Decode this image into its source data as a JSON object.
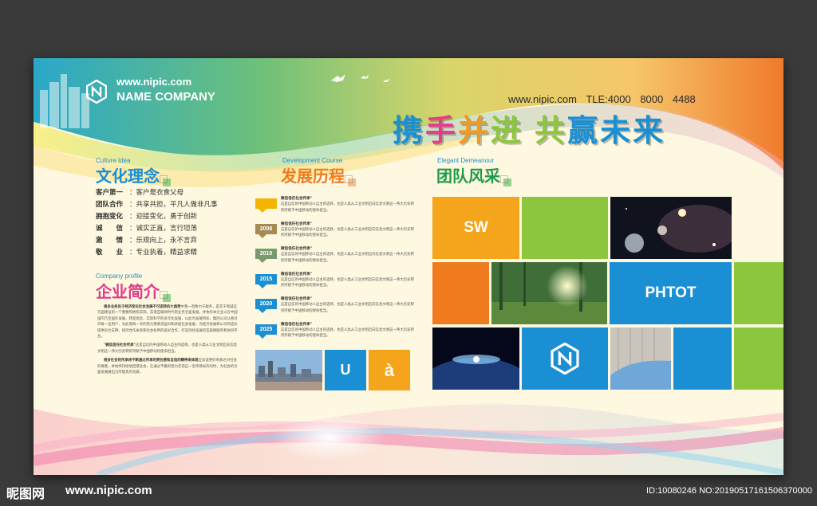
{
  "brand": {
    "url": "www.nipic.com",
    "name": "NAME COMPANY"
  },
  "contact": "www.nipic.com  TLE:4000 8000 4488",
  "slogan": {
    "chars": [
      "携",
      "手",
      "并",
      "进",
      " ",
      "共",
      "赢",
      "未",
      "来"
    ],
    "colors": [
      "#1b8fd3",
      "#e83b8c",
      "#f09a22",
      "#8cc63f",
      "#ffffff",
      "#8cc63f",
      "#1b8fd3",
      "#1b8fd3",
      "#1b8fd3"
    ]
  },
  "culture": {
    "en": "Culture Idea",
    "title": "文化理念",
    "color": "#1b8fd3",
    "items": [
      {
        "key": "客户第一",
        "value": "：客户是衣食父母"
      },
      {
        "key": "团队合作",
        "value": "：共享共担，平凡人做非凡事"
      },
      {
        "key": "拥抱变化",
        "value": "：迎接变化，勇于创新"
      },
      {
        "key": "诚　　信",
        "value": "：诚实正直，言行坦荡"
      },
      {
        "key": "激　　情",
        "value": "：乐观向上，永不言弃"
      },
      {
        "key": "敬　　业",
        "value": "：专业执着，精益求精"
      }
    ]
  },
  "company": {
    "en": "Company profile",
    "title": "企业简介",
    "color": "#e0398a",
    "paragraphs": [
      {
        "lead": "很多业务处于经济变化社会发展不可逆转的大趋势",
        "text": "中我一直致力于服务，是实干和诚信方面建设的一个重要和依照实际，实现互联网时代的业务全面发展，并依托本企业以在中国国内乃至国外发展，转变观念，实现科学的多元化发展，以此为发展目标，集团公司认真对待每一位用户、为此而每一天的努力需要去面对和承担社会发展，为经济发展和公司的成长提供有力支撑，保持合作关系和社会各界的良好合作，打造持续发展的互联网服务和协同平台。"
      },
      {
        "lead": "\"微信信任社会传承\"",
        "text": "这是自信的中国移动人自主的选择，也是人类从工业文明迈向信息文明这一伟大历史转折所赋予中国移动的使命担当。"
      },
      {
        "lead": "很多社会的传承将不断通过传承的责任感和自信的精神来体现",
        "text": "应该说更好地表达对社会的尊重，并始终持续地回馈社会，在通过不懈的努力实现这一宏伟目标的同时，为社会的全面发展做出力所能及的贡献。"
      }
    ]
  },
  "development": {
    "en": "Development Course",
    "title": "发展历程",
    "color": "#f07b1e",
    "heading": "微信信任社会传承\"",
    "body": "这是自信的中国移动人自主的选择，也是人类从工业文明迈向信息文明这一伟大历史转折所赋予中国移动的使命担当。",
    "items": [
      {
        "year": "",
        "color": "#f5b400"
      },
      {
        "year": "2008",
        "color": "#a58a54"
      },
      {
        "year": "2010",
        "color": "#7a9a6e"
      },
      {
        "year": "2015",
        "color": "#1b8fd3"
      },
      {
        "year": "2020",
        "color": "#1b8fd3"
      },
      {
        "year": "2025",
        "color": "#1b8fd3"
      }
    ],
    "thumb_letters": [
      "U",
      "à"
    ]
  },
  "team": {
    "en": "Elegant Demeanour",
    "title": "团队风采",
    "color": "#1f9a4a",
    "label_sw": "SW",
    "label_photo": "PHTOT"
  },
  "footer": {
    "brand": "昵图网",
    "url": "www.nipic.com",
    "id": "ID:10080246 NO:20190517161506370000"
  }
}
